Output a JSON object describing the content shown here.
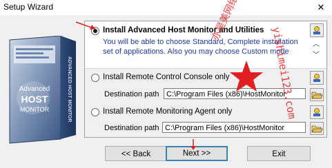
{
  "window": {
    "title": "Setup Wizard",
    "close_glyph": "✕"
  },
  "banner": {
    "logo_lines": [
      "Advanced",
      "HOST",
      "MONITOR"
    ],
    "side_text": "ADVANCED HOST MONITOR"
  },
  "options": [
    {
      "title": "Install Advanced Host Monitor and Utilities",
      "selected": true,
      "description": [
        "You will be able to choose Standard, Complete installation",
        "set of applications. Also you may choose Custom mode"
      ]
    },
    {
      "title": "Install Remote Control Console only",
      "selected": false,
      "destination_label": "Destination path",
      "destination_value": "C:\\Program Files (x86)\\HostMonitor"
    },
    {
      "title": "Install Remote Monitoring Agent only",
      "selected": false,
      "destination_label": "Destination path",
      "destination_value": "C:\\Program Files (x86)\\HostMonitor"
    }
  ],
  "buttons": {
    "back": "<< Back",
    "next": "Next >>",
    "exit": "Exit"
  },
  "watermark": {
    "text": "亦是美网络 · 精品资源",
    "url": "yishimei123.com"
  },
  "colors": {
    "description_text": "#1f3a9a",
    "watermark_red": "#e02020",
    "marker_red": "#e02020"
  },
  "icons": [
    "close-icon",
    "help-icon",
    "scroll-up-icon",
    "scroll-down-icon",
    "browse-folder-icon",
    "red-star-stamp"
  ]
}
